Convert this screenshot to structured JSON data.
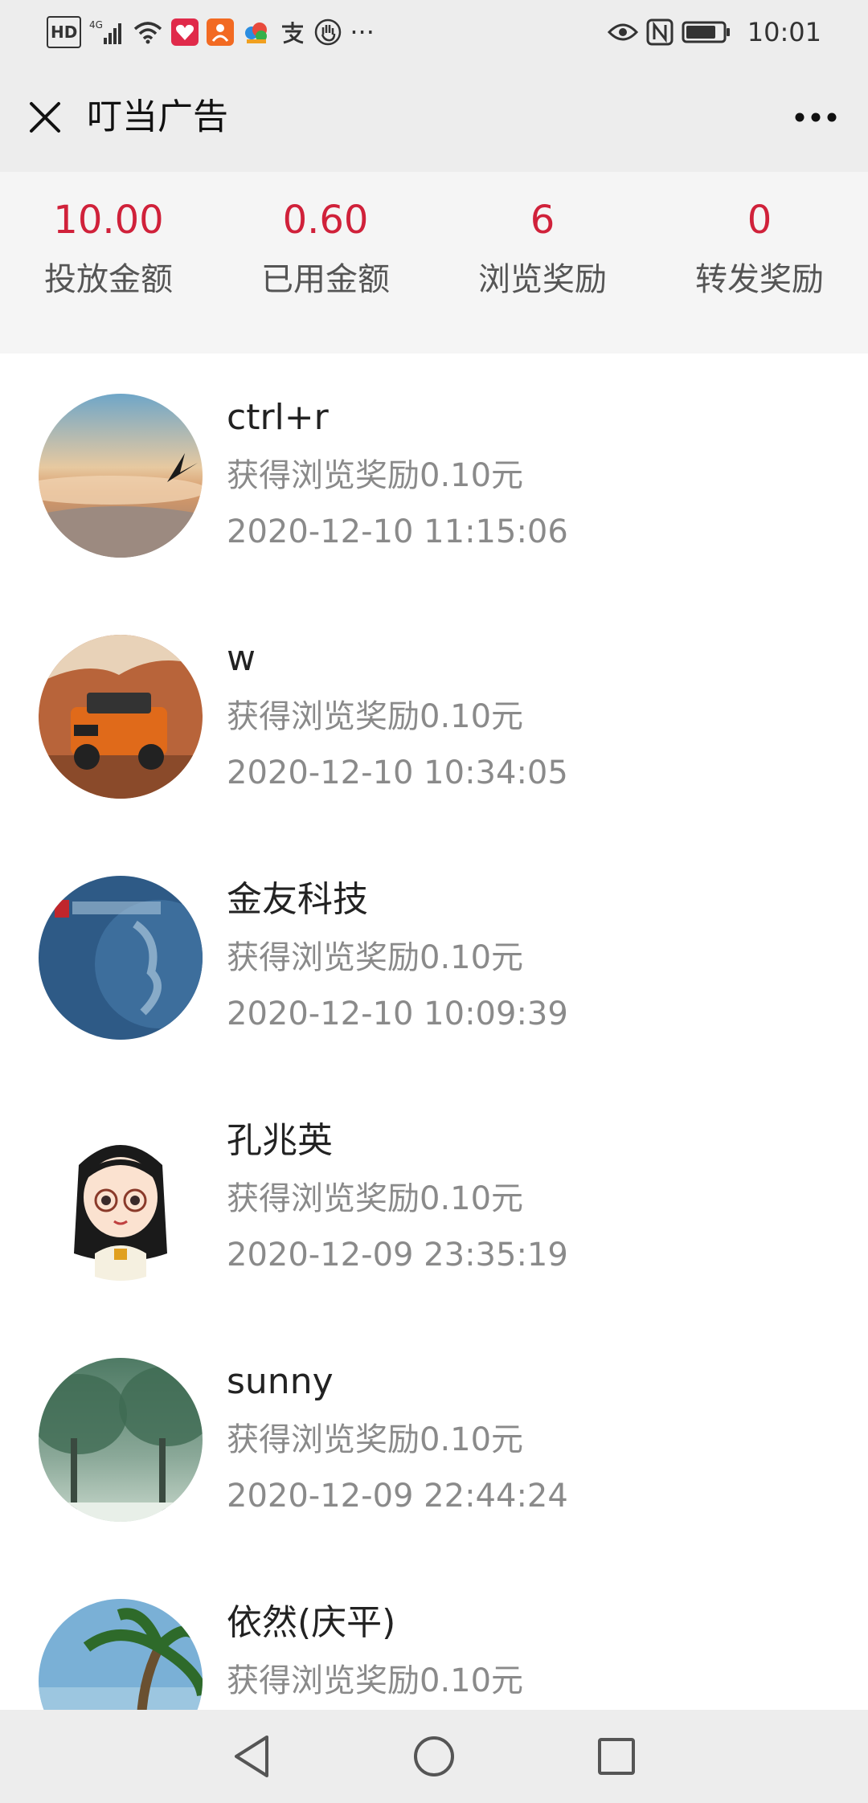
{
  "status_bar": {
    "left_icons": [
      "hd-icon",
      "signal-4g-icon",
      "wifi-icon",
      "app-heart-icon",
      "app-orange-icon",
      "app-cloud-icon",
      "alipay-icon",
      "hand-icon",
      "more-dots-icon"
    ],
    "hd_label": "HD",
    "network_label": "4G",
    "overflow": "···",
    "right_icons": [
      "eye-icon",
      "nfc-icon",
      "battery-icon"
    ],
    "time": "10:01"
  },
  "titlebar": {
    "title": "叮当广告",
    "close_icon": "close-icon",
    "more_icon": "more-horizontal-icon"
  },
  "stats": [
    {
      "value": "10.00",
      "label": "投放金额"
    },
    {
      "value": "0.60",
      "label": "已用金额"
    },
    {
      "value": "6",
      "label": "浏览奖励"
    },
    {
      "value": "0",
      "label": "转发奖励"
    }
  ],
  "colors": {
    "accent_red": "#d0213a",
    "header_bg": "#ededed",
    "stats_bg": "#f5f5f5",
    "secondary_text": "#8a8a8a"
  },
  "items": [
    {
      "name": "ctrl+r",
      "desc": "获得浏览奖励0.10元",
      "time": "2020-12-10 11:15:06",
      "avatar": "sunset-eagle-avatar"
    },
    {
      "name": "w",
      "desc": "获得浏览奖励0.10元",
      "time": "2020-12-10 10:34:05",
      "avatar": "orange-suv-avatar"
    },
    {
      "name": "金友科技",
      "desc": "获得浏览奖励0.10元",
      "time": "2020-12-10 10:09:39",
      "avatar": "globe-logo-avatar"
    },
    {
      "name": "孔兆英",
      "desc": "获得浏览奖励0.10元",
      "time": "2020-12-09 23:35:19",
      "avatar": "cartoon-girl-avatar"
    },
    {
      "name": "sunny",
      "desc": "获得浏览奖励0.10元",
      "time": "2020-12-09 22:44:24",
      "avatar": "forest-avatar"
    },
    {
      "name": "依然(庆平)",
      "desc": "获得浏览奖励0.10元",
      "time": "",
      "avatar": "palm-tree-avatar"
    }
  ],
  "navbar": {
    "icons": [
      "back-triangle-icon",
      "home-circle-icon",
      "recents-square-icon"
    ]
  }
}
